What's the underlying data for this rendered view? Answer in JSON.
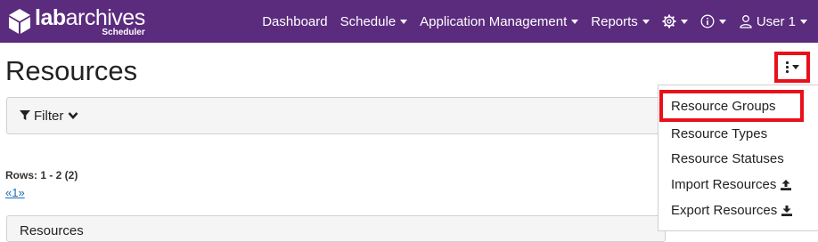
{
  "brand": {
    "name_bold": "lab",
    "name_rest": "archives",
    "sub": "Scheduler"
  },
  "nav": {
    "dashboard": "Dashboard",
    "schedule": "Schedule",
    "app_mgmt": "Application Management",
    "reports": "Reports",
    "user": "User 1"
  },
  "page": {
    "title": "Resources"
  },
  "filter": {
    "label": "Filter"
  },
  "rows_text": "Rows: 1 - 2 (2)",
  "pager": "«1»",
  "panel_title": "Resources",
  "dropdown": {
    "items": [
      {
        "label": "Resource Groups"
      },
      {
        "label": "Resource Types"
      },
      {
        "label": "Resource Statuses"
      },
      {
        "label": "Import Resources"
      },
      {
        "label": "Export Resources"
      }
    ]
  },
  "colors": {
    "navbar": "#5b2b7e",
    "highlight": "#e8101a",
    "link": "#1a6bb0"
  },
  "icons": [
    "cube-logo-icon",
    "gear-icon",
    "info-icon",
    "user-icon",
    "kebab-icon",
    "filter-icon",
    "chevron-down-icon",
    "upload-icon",
    "download-icon"
  ]
}
